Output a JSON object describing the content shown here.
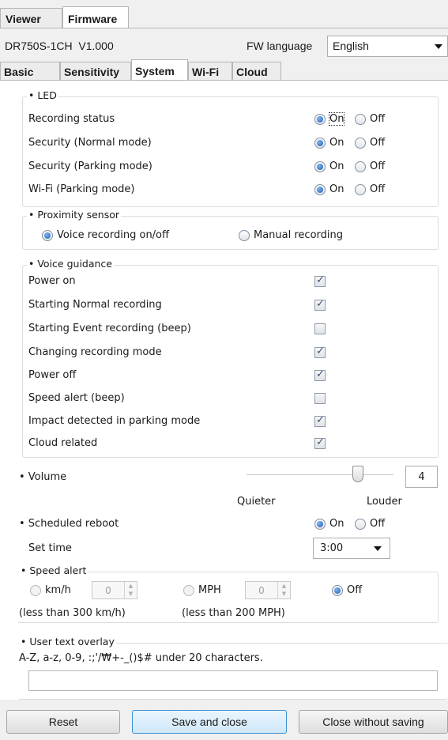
{
  "tabs": [
    "Viewer",
    "Firmware"
  ],
  "device": {
    "model": "DR750S-1CH",
    "version": "V1.000"
  },
  "fw_language": {
    "label": "FW language",
    "value": "English"
  },
  "settings_tabs": [
    "Basic",
    "Sensitivity",
    "System",
    "Wi-Fi",
    "Cloud"
  ],
  "led": {
    "title": "• LED",
    "rows": [
      {
        "label": "Recording status",
        "on": "On",
        "off": "Off"
      },
      {
        "label": "Security (Normal mode)",
        "on": "On",
        "off": "Off"
      },
      {
        "label": "Security (Parking mode)",
        "on": "On",
        "off": "Off"
      },
      {
        "label": "Wi-Fi (Parking mode)",
        "on": "On",
        "off": "Off"
      }
    ]
  },
  "proximity": {
    "title": "• Proximity sensor",
    "opt_voice": "Voice recording on/off",
    "opt_manual": "Manual recording"
  },
  "voice": {
    "title": "• Voice guidance",
    "items": [
      {
        "label": "Power on",
        "checked": true
      },
      {
        "label": "Starting Normal recording",
        "checked": true
      },
      {
        "label": "Starting Event recording (beep)",
        "checked": false
      },
      {
        "label": "Changing recording mode",
        "checked": true
      },
      {
        "label": "Power off",
        "checked": true
      },
      {
        "label": "Speed alert (beep)",
        "checked": false
      },
      {
        "label": "Impact detected in parking mode",
        "checked": true
      },
      {
        "label": "Cloud related",
        "checked": true
      }
    ]
  },
  "volume": {
    "label": "• Volume",
    "value": "4",
    "quieter": "Quieter",
    "louder": "Louder",
    "level": 0.73
  },
  "reboot": {
    "label": "• Scheduled reboot",
    "on": "On",
    "off": "Off",
    "set_time_label": "Set time",
    "time": "3:00"
  },
  "speed": {
    "title": "• Speed alert",
    "kmh": "km/h",
    "kmh_val": "0",
    "kmh_note": "(less than 300 km/h)",
    "mph": "MPH",
    "mph_val": "0",
    "mph_note": "(less than 200 MPH)",
    "off": "Off"
  },
  "overlay": {
    "title": "• User text overlay",
    "hint": "A-Z, a-z, 0-9, :;'/₩+-_()$# under 20 characters.",
    "value": ""
  },
  "buttons": {
    "reset": "Reset",
    "save": "Save and close",
    "close": "Close without saving"
  }
}
